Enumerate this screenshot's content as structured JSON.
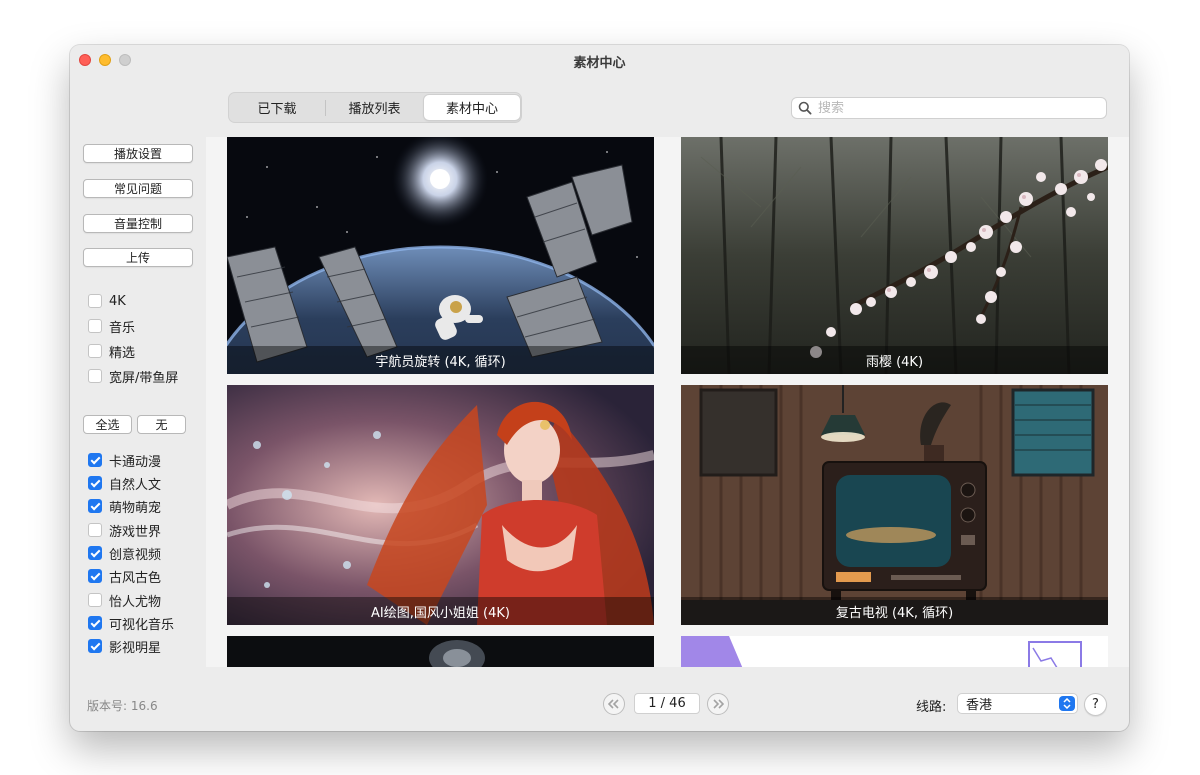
{
  "window": {
    "title": "素材中心"
  },
  "tabs": [
    {
      "label": "已下载",
      "active": false
    },
    {
      "label": "播放列表",
      "active": false
    },
    {
      "label": "素材中心",
      "active": true
    }
  ],
  "search": {
    "placeholder": "搜索",
    "value": ""
  },
  "sidebar": {
    "buttons": [
      "播放设置",
      "常见问题",
      "音量控制",
      "上传"
    ],
    "filters": [
      {
        "label": "4K",
        "checked": false
      },
      {
        "label": "音乐",
        "checked": false
      },
      {
        "label": "精选",
        "checked": false
      },
      {
        "label": "宽屏/带鱼屏",
        "checked": false
      }
    ],
    "select_all_label": "全选",
    "select_none_label": "无",
    "categories": [
      {
        "label": "卡通动漫",
        "checked": true
      },
      {
        "label": "自然人文",
        "checked": true
      },
      {
        "label": "萌物萌宠",
        "checked": true
      },
      {
        "label": "游戏世界",
        "checked": false
      },
      {
        "label": "创意视频",
        "checked": true
      },
      {
        "label": "古风古色",
        "checked": true
      },
      {
        "label": "怡人尤物",
        "checked": false
      },
      {
        "label": "可视化音乐",
        "checked": true
      },
      {
        "label": "影视明星",
        "checked": true
      }
    ]
  },
  "grid": {
    "items": [
      {
        "caption": "宇航员旋转 (4K, 循环)",
        "scene": "astronaut"
      },
      {
        "caption": "雨樱 (4K)",
        "scene": "sakura"
      },
      {
        "caption": "AI绘图,国风小姐姐 (4K)",
        "scene": "ai-girl"
      },
      {
        "caption": "复古电视 (4K, 循环)",
        "scene": "retro-tv"
      },
      {
        "caption": "",
        "scene": "dark-partial"
      },
      {
        "caption": "",
        "scene": "purple-partial"
      }
    ]
  },
  "footer": {
    "version": "版本号: 16.6",
    "page_indicator": "1 / 46",
    "prev_icon": "double-chevron-left-icon",
    "next_icon": "double-chevron-right-icon",
    "route_label": "线路:",
    "route_value": "香港",
    "help_label": "?"
  },
  "colors": {
    "accent": "#1f77f0",
    "window_bg": "#ececec"
  }
}
